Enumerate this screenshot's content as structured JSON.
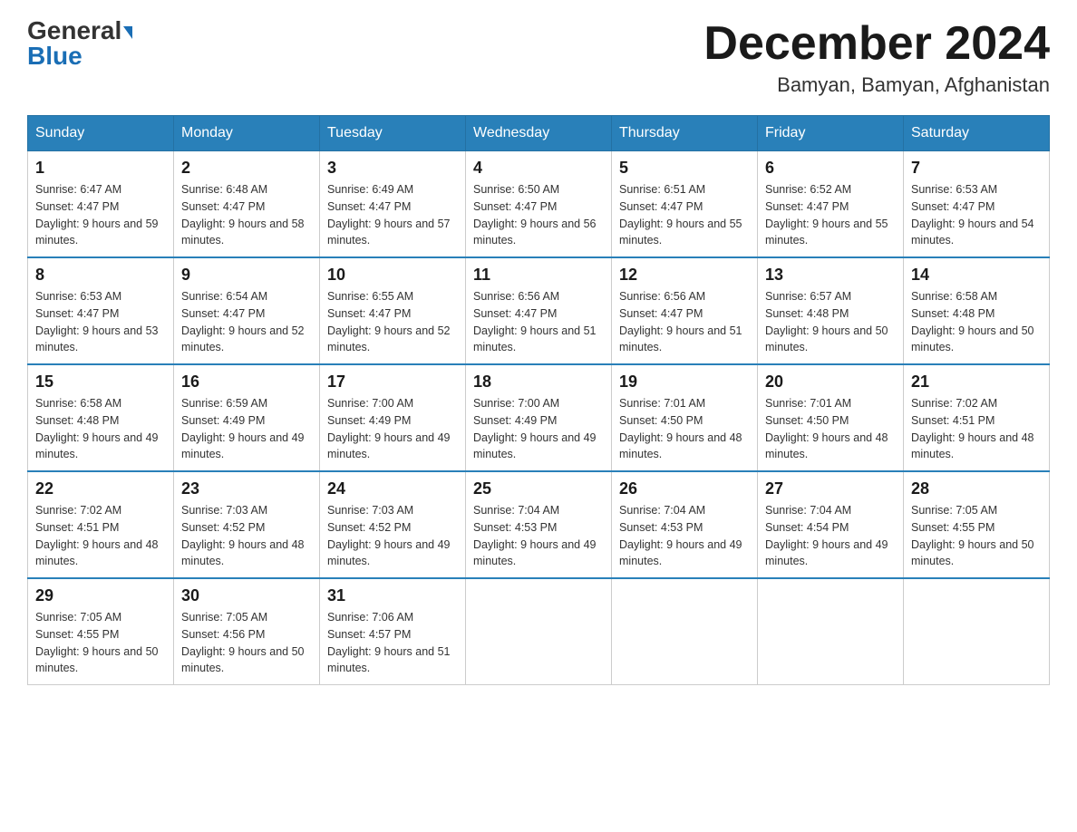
{
  "logo": {
    "general": "General",
    "triangle": "▶",
    "blue": "Blue"
  },
  "title": "December 2024",
  "subtitle": "Bamyan, Bamyan, Afghanistan",
  "days_of_week": [
    "Sunday",
    "Monday",
    "Tuesday",
    "Wednesday",
    "Thursday",
    "Friday",
    "Saturday"
  ],
  "weeks": [
    [
      {
        "date": "1",
        "sunrise": "6:47 AM",
        "sunset": "4:47 PM",
        "daylight": "9 hours and 59 minutes."
      },
      {
        "date": "2",
        "sunrise": "6:48 AM",
        "sunset": "4:47 PM",
        "daylight": "9 hours and 58 minutes."
      },
      {
        "date": "3",
        "sunrise": "6:49 AM",
        "sunset": "4:47 PM",
        "daylight": "9 hours and 57 minutes."
      },
      {
        "date": "4",
        "sunrise": "6:50 AM",
        "sunset": "4:47 PM",
        "daylight": "9 hours and 56 minutes."
      },
      {
        "date": "5",
        "sunrise": "6:51 AM",
        "sunset": "4:47 PM",
        "daylight": "9 hours and 55 minutes."
      },
      {
        "date": "6",
        "sunrise": "6:52 AM",
        "sunset": "4:47 PM",
        "daylight": "9 hours and 55 minutes."
      },
      {
        "date": "7",
        "sunrise": "6:53 AM",
        "sunset": "4:47 PM",
        "daylight": "9 hours and 54 minutes."
      }
    ],
    [
      {
        "date": "8",
        "sunrise": "6:53 AM",
        "sunset": "4:47 PM",
        "daylight": "9 hours and 53 minutes."
      },
      {
        "date": "9",
        "sunrise": "6:54 AM",
        "sunset": "4:47 PM",
        "daylight": "9 hours and 52 minutes."
      },
      {
        "date": "10",
        "sunrise": "6:55 AM",
        "sunset": "4:47 PM",
        "daylight": "9 hours and 52 minutes."
      },
      {
        "date": "11",
        "sunrise": "6:56 AM",
        "sunset": "4:47 PM",
        "daylight": "9 hours and 51 minutes."
      },
      {
        "date": "12",
        "sunrise": "6:56 AM",
        "sunset": "4:47 PM",
        "daylight": "9 hours and 51 minutes."
      },
      {
        "date": "13",
        "sunrise": "6:57 AM",
        "sunset": "4:48 PM",
        "daylight": "9 hours and 50 minutes."
      },
      {
        "date": "14",
        "sunrise": "6:58 AM",
        "sunset": "4:48 PM",
        "daylight": "9 hours and 50 minutes."
      }
    ],
    [
      {
        "date": "15",
        "sunrise": "6:58 AM",
        "sunset": "4:48 PM",
        "daylight": "9 hours and 49 minutes."
      },
      {
        "date": "16",
        "sunrise": "6:59 AM",
        "sunset": "4:49 PM",
        "daylight": "9 hours and 49 minutes."
      },
      {
        "date": "17",
        "sunrise": "7:00 AM",
        "sunset": "4:49 PM",
        "daylight": "9 hours and 49 minutes."
      },
      {
        "date": "18",
        "sunrise": "7:00 AM",
        "sunset": "4:49 PM",
        "daylight": "9 hours and 49 minutes."
      },
      {
        "date": "19",
        "sunrise": "7:01 AM",
        "sunset": "4:50 PM",
        "daylight": "9 hours and 48 minutes."
      },
      {
        "date": "20",
        "sunrise": "7:01 AM",
        "sunset": "4:50 PM",
        "daylight": "9 hours and 48 minutes."
      },
      {
        "date": "21",
        "sunrise": "7:02 AM",
        "sunset": "4:51 PM",
        "daylight": "9 hours and 48 minutes."
      }
    ],
    [
      {
        "date": "22",
        "sunrise": "7:02 AM",
        "sunset": "4:51 PM",
        "daylight": "9 hours and 48 minutes."
      },
      {
        "date": "23",
        "sunrise": "7:03 AM",
        "sunset": "4:52 PM",
        "daylight": "9 hours and 48 minutes."
      },
      {
        "date": "24",
        "sunrise": "7:03 AM",
        "sunset": "4:52 PM",
        "daylight": "9 hours and 49 minutes."
      },
      {
        "date": "25",
        "sunrise": "7:04 AM",
        "sunset": "4:53 PM",
        "daylight": "9 hours and 49 minutes."
      },
      {
        "date": "26",
        "sunrise": "7:04 AM",
        "sunset": "4:53 PM",
        "daylight": "9 hours and 49 minutes."
      },
      {
        "date": "27",
        "sunrise": "7:04 AM",
        "sunset": "4:54 PM",
        "daylight": "9 hours and 49 minutes."
      },
      {
        "date": "28",
        "sunrise": "7:05 AM",
        "sunset": "4:55 PM",
        "daylight": "9 hours and 50 minutes."
      }
    ],
    [
      {
        "date": "29",
        "sunrise": "7:05 AM",
        "sunset": "4:55 PM",
        "daylight": "9 hours and 50 minutes."
      },
      {
        "date": "30",
        "sunrise": "7:05 AM",
        "sunset": "4:56 PM",
        "daylight": "9 hours and 50 minutes."
      },
      {
        "date": "31",
        "sunrise": "7:06 AM",
        "sunset": "4:57 PM",
        "daylight": "9 hours and 51 minutes."
      },
      null,
      null,
      null,
      null
    ]
  ]
}
